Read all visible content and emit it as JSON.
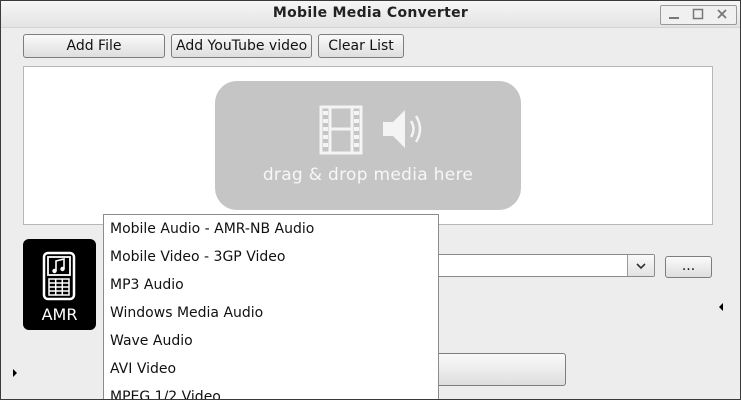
{
  "window": {
    "title": "Mobile Media Converter",
    "controls": [
      "minimize-icon",
      "maximize-icon",
      "close-icon"
    ]
  },
  "toolbar": {
    "add_file_label": "Add File",
    "add_youtube_label": "Add YouTube video",
    "clear_list_label": "Clear List"
  },
  "drop_area": {
    "text": "drag & drop media here",
    "icons": [
      "film-icon",
      "speaker-icon"
    ]
  },
  "output_format": {
    "icon_label": "AMR",
    "icon": "music-phone-icon",
    "browse_label": "...",
    "selected_value": ""
  },
  "format_dropdown": {
    "items": [
      "Mobile Audio - AMR-NB Audio",
      "Mobile Video - 3GP Video",
      "MP3 Audio",
      "Windows Media Audio",
      "Wave Audio",
      "AVI Video",
      "MPEG 1/2 Video"
    ]
  },
  "colors": {
    "drop_box": "#c5c5c5",
    "window_bg": "#ededed",
    "icon_bg": "#000000"
  }
}
